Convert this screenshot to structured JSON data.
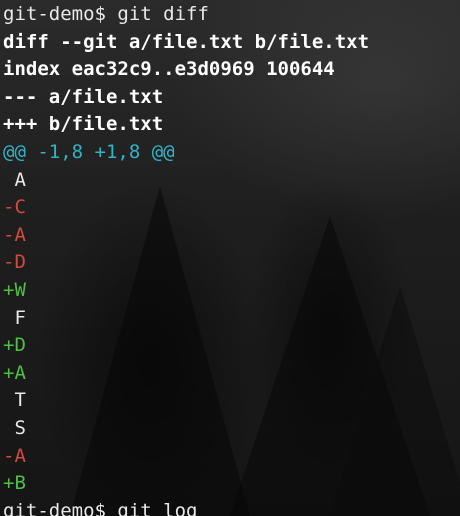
{
  "terminal": {
    "lines": [
      {
        "text": "git-demo$ git diff",
        "kind": "prompt"
      },
      {
        "text": "diff --git a/file.txt b/file.txt",
        "kind": "meta"
      },
      {
        "text": "index eac32c9..e3d0969 100644",
        "kind": "meta"
      },
      {
        "text": "--- a/file.txt",
        "kind": "meta"
      },
      {
        "text": "+++ b/file.txt",
        "kind": "meta"
      },
      {
        "text": "@@ -1,8 +1,8 @@",
        "kind": "hunk"
      },
      {
        "text": " A",
        "kind": "context"
      },
      {
        "text": "-C",
        "kind": "del"
      },
      {
        "text": "-A",
        "kind": "del"
      },
      {
        "text": "-D",
        "kind": "del"
      },
      {
        "text": "+W",
        "kind": "add"
      },
      {
        "text": " F",
        "kind": "context"
      },
      {
        "text": "+D",
        "kind": "add"
      },
      {
        "text": "+A",
        "kind": "add"
      },
      {
        "text": " T",
        "kind": "context"
      },
      {
        "text": " S",
        "kind": "context"
      },
      {
        "text": "-A",
        "kind": "del"
      },
      {
        "text": "+B",
        "kind": "add"
      },
      {
        "text": "git-demo$ git log",
        "kind": "prompt"
      }
    ]
  },
  "colors": {
    "default_text": "#e9e9e9",
    "meta_text": "#ffffff",
    "hunk": "#33b3c6",
    "deleted": "#d44a3a",
    "added": "#4fbf45"
  }
}
